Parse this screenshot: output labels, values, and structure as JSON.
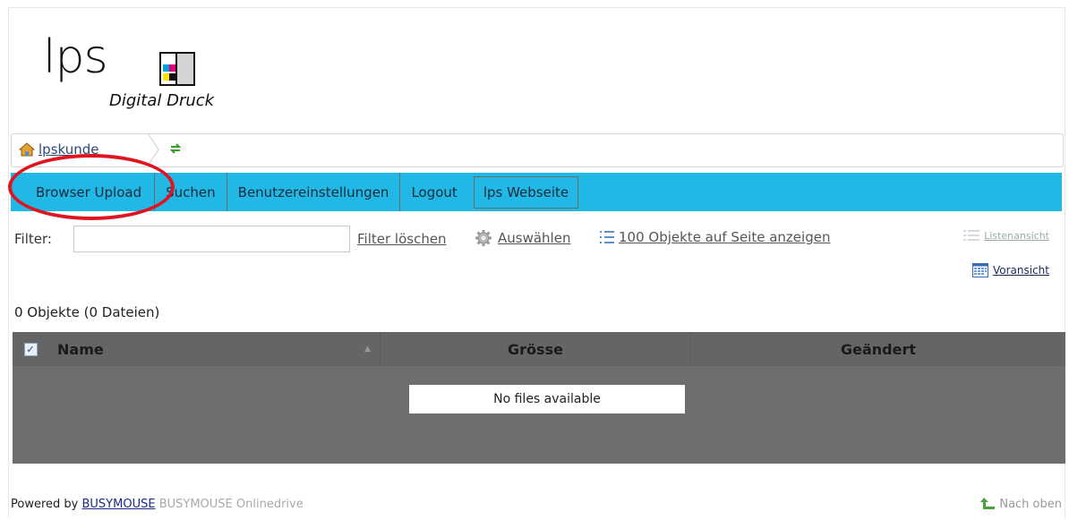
{
  "logo": {
    "wordmark": "lps",
    "subtitle": "Digital Druck",
    "square_colors": [
      "#00a0e0",
      "#e0007a",
      "#ffe000",
      "#111111"
    ]
  },
  "breadcrumb": {
    "home_icon": "home-icon",
    "home_label": "lpskunde",
    "refresh_icon": "refresh-icon"
  },
  "nav": {
    "items": [
      {
        "label": "Browser Upload"
      },
      {
        "label": "Suchen"
      },
      {
        "label": "Benutzereinstellungen"
      },
      {
        "label": "Logout"
      },
      {
        "label": "lps Webseite"
      }
    ],
    "bar_color": "#21b8e5"
  },
  "filter": {
    "label": "Filter:",
    "value": "",
    "clear_label": "Filter löschen",
    "select_label": "Auswählen",
    "select_icon": "gear-icon",
    "per_page_label": "100 Objekte auf Seite anzeigen",
    "per_page_icon": "list-icon",
    "list_view_label": "Listenansicht",
    "preview_label": "Voransicht"
  },
  "summary": {
    "count_text": "0 Objekte (0 Dateien)"
  },
  "table": {
    "columns": [
      "Name",
      "Grösse",
      "Geändert"
    ],
    "empty_text": "No files available",
    "select_all_checked": true
  },
  "footer": {
    "powered_prefix": "Powered by",
    "brand_link": "BUSYMOUSE",
    "brand_suffix": "BUSYMOUSE Onlinedrive",
    "back_to_top": "Nach oben"
  },
  "annotation": {
    "highlight_color": "#e0141e"
  }
}
